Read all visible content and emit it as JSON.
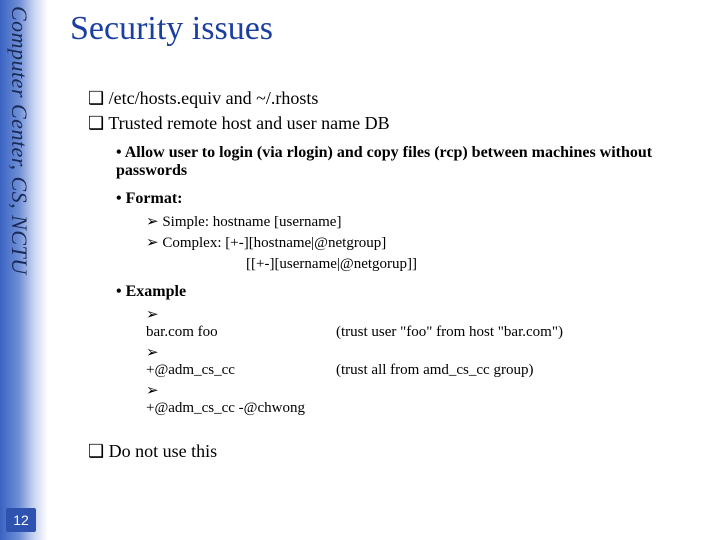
{
  "sidebar": {
    "label": "Computer Center, CS, NCTU",
    "page_number": "12"
  },
  "title": "Security issues",
  "top_items": [
    "/etc/hosts.equiv and ~/.rhosts",
    "Trusted remote host and user name DB"
  ],
  "sub": {
    "allow": "Allow user to login (via rlogin) and copy files (rcp) between machines without passwords",
    "format_label": "Format:",
    "format_items": {
      "simple": "Simple: hostname [username]",
      "complex_line1": "Complex: [+-][hostname|@netgroup]",
      "complex_line2": "[[+-][username|@netgorup]]"
    },
    "example_label": "Example",
    "examples": [
      {
        "left": "bar.com foo",
        "right": "(trust user \"foo\" from host \"bar.com\")"
      },
      {
        "left": "+@adm_cs_cc",
        "right": "(trust all from amd_cs_cc group)"
      },
      {
        "left": "+@adm_cs_cc -@chwong",
        "right": ""
      }
    ]
  },
  "final": "Do not use this"
}
